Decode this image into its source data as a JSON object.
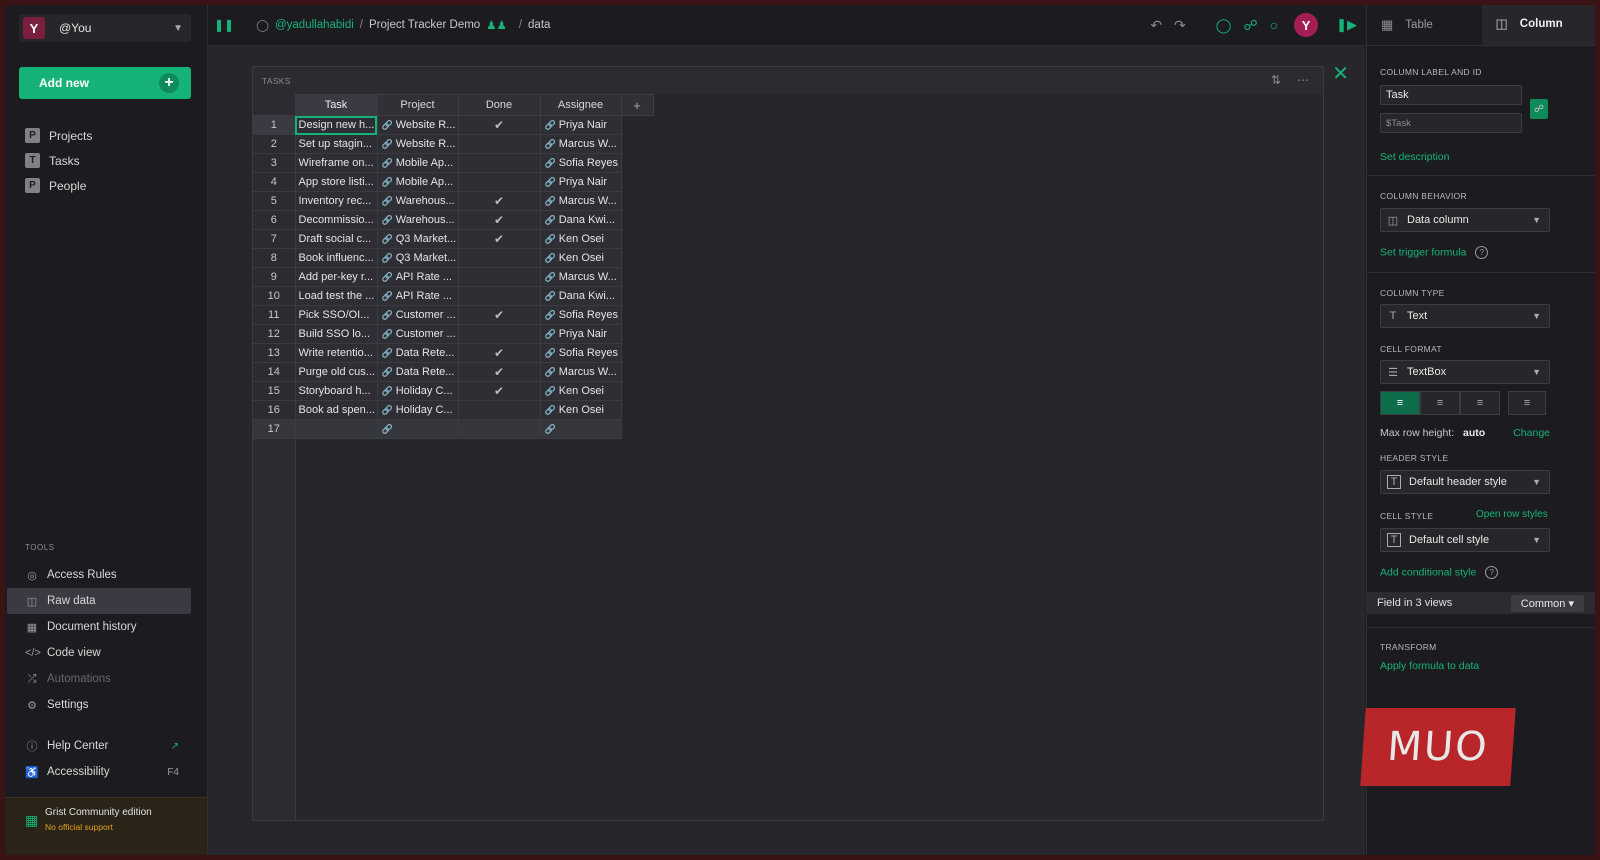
{
  "account": {
    "initial": "Y",
    "name": "@You"
  },
  "add_new": "Add new",
  "pages": [
    {
      "icon": "P",
      "label": "Projects"
    },
    {
      "icon": "T",
      "label": "Tasks"
    },
    {
      "icon": "P",
      "label": "People"
    }
  ],
  "tools_header": "TOOLS",
  "tools": [
    {
      "label": "Access Rules"
    },
    {
      "label": "Raw data"
    },
    {
      "label": "Document history"
    },
    {
      "label": "Code view"
    },
    {
      "label": "Automations"
    },
    {
      "label": "Settings"
    }
  ],
  "help": [
    {
      "label": "Help Center"
    },
    {
      "label": "Accessibility",
      "shortcut": "F4"
    }
  ],
  "community": {
    "title": "Grist Community edition",
    "subtitle": "No official support"
  },
  "breadcrumb": {
    "workspace": "@yadullahabidi",
    "document": "Project Tracker Demo",
    "page": "data"
  },
  "topbar": {
    "avatar": "Y"
  },
  "section": {
    "title": "TASKS"
  },
  "table": {
    "columns": [
      "Task",
      "Project",
      "Done",
      "Assignee"
    ],
    "add_column": "+",
    "rows": [
      {
        "n": "1",
        "task": "Design new h...",
        "project": "Website R...",
        "done": true,
        "assignee": "Priya Nair"
      },
      {
        "n": "2",
        "task": "Set up stagin...",
        "project": "Website R...",
        "done": false,
        "assignee": "Marcus W..."
      },
      {
        "n": "3",
        "task": "Wireframe on...",
        "project": "Mobile Ap...",
        "done": false,
        "assignee": "Sofia Reyes"
      },
      {
        "n": "4",
        "task": "App store listi...",
        "project": "Mobile Ap...",
        "done": false,
        "assignee": "Priya Nair"
      },
      {
        "n": "5",
        "task": "Inventory rec...",
        "project": "Warehous...",
        "done": true,
        "assignee": "Marcus W..."
      },
      {
        "n": "6",
        "task": "Decommissio...",
        "project": "Warehous...",
        "done": true,
        "assignee": "Dana Kwi..."
      },
      {
        "n": "7",
        "task": "Draft social c...",
        "project": "Q3 Market...",
        "done": true,
        "assignee": "Ken Osei"
      },
      {
        "n": "8",
        "task": "Book influenc...",
        "project": "Q3 Market...",
        "done": false,
        "assignee": "Ken Osei"
      },
      {
        "n": "9",
        "task": "Add per-key r...",
        "project": "API Rate ...",
        "done": false,
        "assignee": "Marcus W..."
      },
      {
        "n": "10",
        "task": "Load test the ...",
        "project": "API Rate ...",
        "done": false,
        "assignee": "Dana Kwi..."
      },
      {
        "n": "11",
        "task": "Pick SSO/OI...",
        "project": "Customer ...",
        "done": true,
        "assignee": "Sofia Reyes"
      },
      {
        "n": "12",
        "task": "Build SSO lo...",
        "project": "Customer ...",
        "done": false,
        "assignee": "Priya Nair"
      },
      {
        "n": "13",
        "task": "Write retentio...",
        "project": "Data Rete...",
        "done": true,
        "assignee": "Sofia Reyes"
      },
      {
        "n": "14",
        "task": "Purge old cus...",
        "project": "Data Rete...",
        "done": true,
        "assignee": "Marcus W..."
      },
      {
        "n": "15",
        "task": "Storyboard h...",
        "project": "Holiday C...",
        "done": true,
        "assignee": "Ken Osei"
      },
      {
        "n": "16",
        "task": "Book ad spen...",
        "project": "Holiday C...",
        "done": false,
        "assignee": "Ken Osei"
      }
    ],
    "new_row_number": "17"
  },
  "right_panel": {
    "tabs": [
      "Table",
      "Column"
    ],
    "label_and_id_header": "COLUMN LABEL AND ID",
    "label_value": "Task",
    "id_value": "$Task",
    "set_description": "Set description",
    "behavior_header": "COLUMN BEHAVIOR",
    "behavior_value": "Data column",
    "set_trigger_formula": "Set trigger formula",
    "type_header": "COLUMN TYPE",
    "type_value": "Text",
    "cell_format_header": "CELL FORMAT",
    "cell_format_value": "TextBox",
    "max_row_height_label": "Max row height:",
    "max_row_height_value": "auto",
    "change": "Change",
    "header_style_header": "HEADER STYLE",
    "header_style_value": "Default header style",
    "cell_style_header": "CELL STYLE",
    "open_row_styles": "Open row styles",
    "cell_style_value": "Default cell style",
    "add_conditional_style": "Add conditional style",
    "field_in_views": "Field in 3 views",
    "common": "Common",
    "transform_header": "TRANSFORM",
    "apply_formula": "Apply formula to data"
  },
  "watermark": "MUO"
}
